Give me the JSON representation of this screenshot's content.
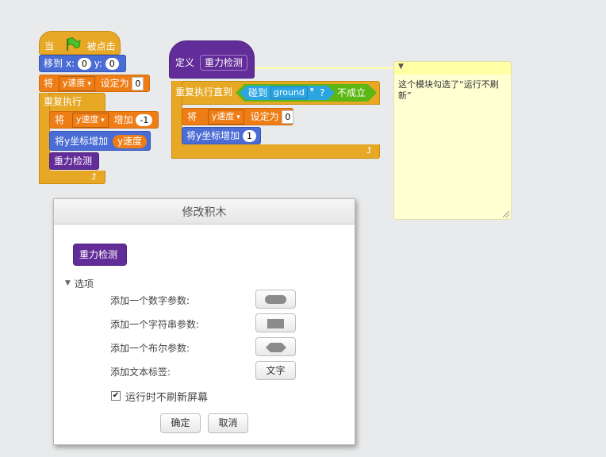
{
  "script1": {
    "hat_when": "当",
    "hat_clicked": "被点击",
    "goto_label": "移到",
    "goto_x_label": "x:",
    "goto_x": "0",
    "goto_y_label": "y:",
    "goto_y": "0",
    "set_prefix": "将",
    "var_name": "y速度",
    "set_to": "设定为",
    "set_value": "0",
    "forever": "重复执行",
    "change_prefix": "将",
    "change_by": "增加",
    "change_value": "-1",
    "change_y_label": "将y坐标增加",
    "change_y_reporter": "y速度",
    "custom_call": "重力检测"
  },
  "script2": {
    "define_label": "定义",
    "define_name": "重力检测",
    "repeat_until": "重复执行直到",
    "touching_label": "碰到",
    "touching_target": "ground",
    "touching_q": "?",
    "not_label": "不成立",
    "set_prefix": "将",
    "var_name": "y速度",
    "set_to": "设定为",
    "set_value": "0",
    "change_y_label": "将y坐标增加",
    "change_y_value": "1"
  },
  "comment": {
    "text": "这个模块勾选了“运行不刷新”"
  },
  "dialog": {
    "title": "修改积木",
    "block_name": "重力检测",
    "options_label": "选项",
    "add_number": "添加一个数字参数:",
    "add_string": "添加一个字符串参数:",
    "add_bool": "添加一个布尔参数:",
    "add_label": "添加文本标签:",
    "add_label_button": "文字",
    "run_without_refresh": "运行时不刷新屏幕",
    "run_without_refresh_checked": true,
    "ok": "确定",
    "cancel": "取消"
  },
  "colors": {
    "background": "#e9eaeb",
    "control": "#e6a825",
    "motion": "#4a6cd4",
    "data": "#ee7d16",
    "more_blocks": "#632d99",
    "sensing": "#2ca5e2",
    "operator": "#5cb712",
    "comment": "#ffffd2"
  }
}
